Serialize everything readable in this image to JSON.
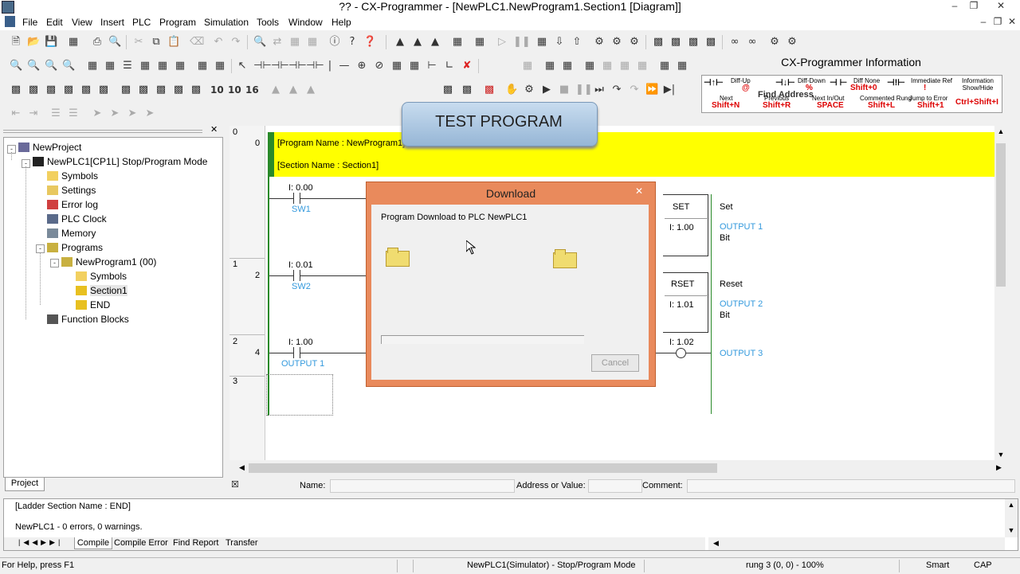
{
  "window": {
    "title": "?? - CX-Programmer - [NewPLC1.NewProgram1.Section1 [Diagram]]"
  },
  "menu": [
    "File",
    "Edit",
    "View",
    "Insert",
    "PLC",
    "Program",
    "Simulation",
    "Tools",
    "Window",
    "Help"
  ],
  "tree": {
    "items": [
      {
        "label": "NewProject"
      },
      {
        "label": "NewPLC1[CP1L] Stop/Program Mode"
      },
      {
        "label": "Symbols"
      },
      {
        "label": "Settings"
      },
      {
        "label": "Error log"
      },
      {
        "label": "PLC Clock"
      },
      {
        "label": "Memory"
      },
      {
        "label": "Programs"
      },
      {
        "label": "NewProgram1 (00)"
      },
      {
        "label": "Symbols"
      },
      {
        "label": "Section1"
      },
      {
        "label": "END"
      },
      {
        "label": "Function Blocks"
      }
    ],
    "tab": "Project"
  },
  "ladder": {
    "program_name": "[Program Name : NewProgram1]",
    "section_name": "[Section Name : Section1]",
    "overlay_label": "TEST PROGRAM",
    "rungs": [
      {
        "num": "0",
        "step": "0",
        "contact_addr": "I: 0.00",
        "contact_name": "SW1",
        "instr": "SET",
        "instr_operand": "I: 1.00",
        "comment": "Set",
        "out_name": "OUTPUT 1",
        "out_type": "Bit"
      },
      {
        "num": "1",
        "step": "2",
        "contact_addr": "I: 0.01",
        "contact_name": "SW2",
        "instr": "RSET",
        "instr_operand": "I: 1.01",
        "comment": "Reset",
        "out_name": "OUTPUT 2",
        "out_type": "Bit"
      },
      {
        "num": "2",
        "step": "4",
        "contact_addr": "I: 1.00",
        "contact_name": "OUTPUT 1",
        "coil_addr": "I: 1.02",
        "out_name": "OUTPUT 3"
      },
      {
        "num": "3"
      }
    ]
  },
  "dialog": {
    "title": "Download",
    "message": "Program Download to PLC NewPLC1",
    "progress": 0,
    "cancel_label": "Cancel"
  },
  "info_panel": {
    "title": "CX-Programmer Information",
    "row1": [
      "Diff-Up",
      "Diff-Down",
      "Diff None",
      "Immediate Ref",
      "Information Show/Hide"
    ],
    "row1_keys": [
      "@",
      "%",
      "Shift+0",
      "!"
    ],
    "row2": [
      "Next",
      "Previous",
      "Next In/Out",
      "Commented Rung",
      "Jump to Error"
    ],
    "row2_keys": [
      "Shift+N",
      "Shift+R",
      "SPACE",
      "Shift+L",
      "Shift+1",
      "Ctrl+Shift+I"
    ],
    "find_address": "Find Address"
  },
  "bottom_bar": {
    "name_label": "Name:",
    "address_label": "Address or Value:",
    "comment_label": "Comment:"
  },
  "output": {
    "line1": "[Ladder Section Name : END]",
    "line2": "NewPLC1 - 0 errors, 0 warnings.",
    "tabs": [
      "Compile",
      "Compile Error",
      "Find Report",
      "Transfer"
    ]
  },
  "status": {
    "help": "For Help, press F1",
    "mode": "NewPLC1(Simulator) - Stop/Program Mode",
    "rung": "rung 3 (0, 0)  - 100%",
    "smart": "Smart",
    "cap": "CAP"
  },
  "colors": {
    "header_yellow": "#ffff00",
    "dialog_orange": "#e98a5c",
    "overlay_blue": "#a9c4e0",
    "link_blue": "#3399dd"
  }
}
